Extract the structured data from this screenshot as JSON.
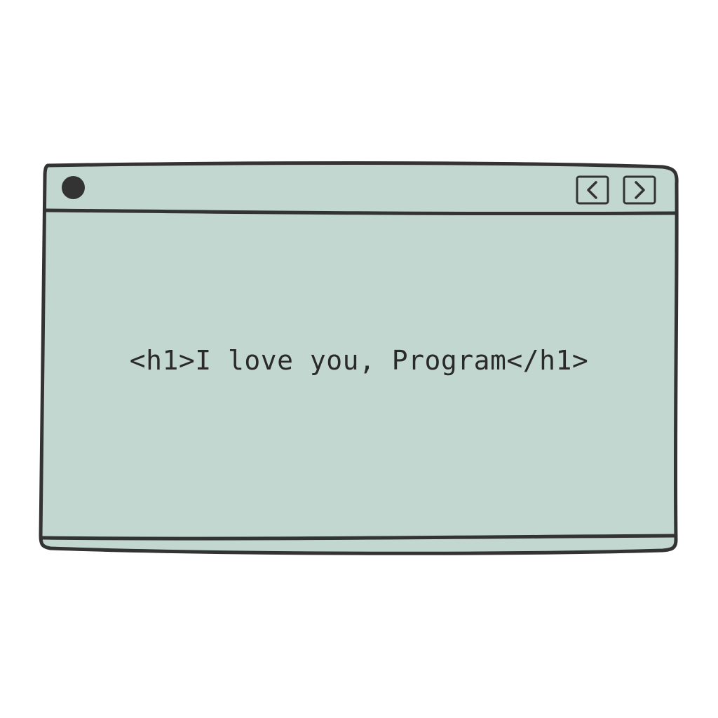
{
  "window": {
    "body_color": "#c3d7d1",
    "outline_color": "#333333",
    "content_text": "<h1>I love you, Program</h1>"
  },
  "titlebar": {
    "icons": [
      "circle-dot-icon",
      "chevron-left-icon",
      "chevron-right-icon"
    ]
  }
}
